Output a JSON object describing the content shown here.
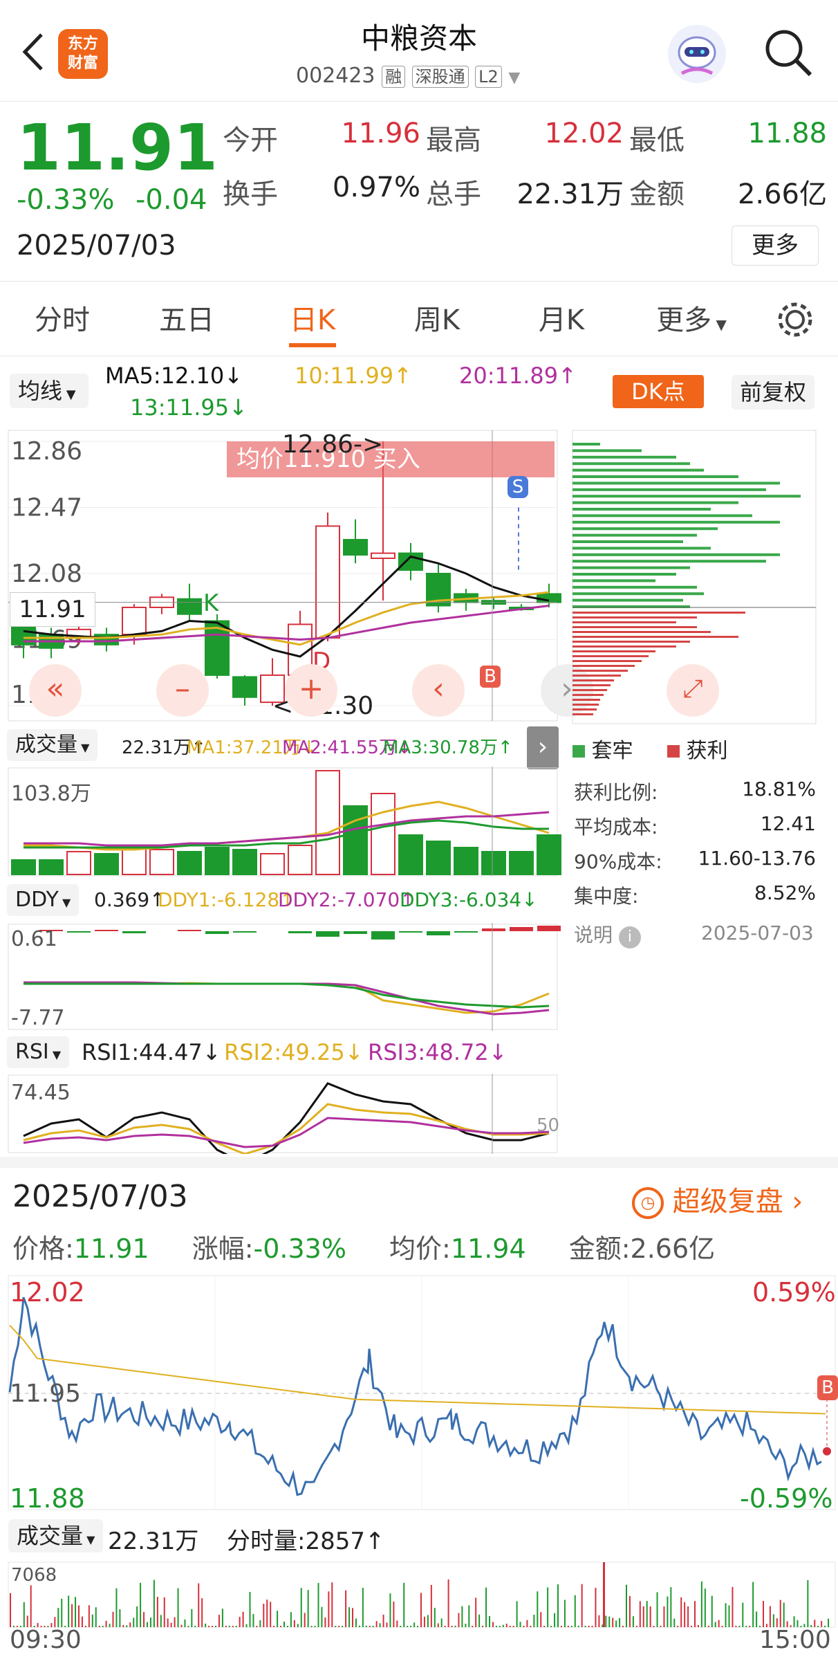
{
  "header": {
    "title": "中粮资本",
    "code": "002423",
    "tags": [
      "融",
      "深股通",
      "L2"
    ],
    "logo_text": [
      "东方",
      "财富"
    ],
    "icons": [
      "back-icon",
      "logo-icon",
      "robot-avatar-icon",
      "search-icon"
    ]
  },
  "quote": {
    "price": "11.91",
    "change_pct": "-0.33%",
    "change": "-0.04",
    "date": "2025/07/03",
    "more_label": "更多",
    "fields": [
      {
        "label": "今开",
        "value": "11.96",
        "color": "up"
      },
      {
        "label": "最高",
        "value": "12.02",
        "color": "up"
      },
      {
        "label": "最低",
        "value": "11.88",
        "color": "dn"
      },
      {
        "label": "换手",
        "value": "0.97%",
        "color": "n"
      },
      {
        "label": "总手",
        "value": "22.31万",
        "color": "n"
      },
      {
        "label": "金额",
        "value": "2.66亿",
        "color": "n"
      }
    ]
  },
  "tabs": [
    {
      "label": "分时",
      "active": false
    },
    {
      "label": "五日",
      "active": false
    },
    {
      "label": "日K",
      "active": true
    },
    {
      "label": "周K",
      "active": false
    },
    {
      "label": "月K",
      "active": false
    },
    {
      "label": "更多",
      "active": false
    }
  ],
  "ma_bar": {
    "selector": "均线",
    "ma5": "MA5:12.10↓",
    "ma10": "10:11.99↑",
    "ma20": "20:11.89↑",
    "ma13": "13:11.95↓",
    "dk_label": "DK点",
    "fq_label": "前复权"
  },
  "kchart": {
    "y_labels": [
      "12.86",
      "12.47",
      "12.08",
      "11.69",
      "11.30"
    ],
    "current_price": "11.91",
    "high_marker": "12.86->",
    "low_marker": "<-11.30",
    "banner": "均价11.910 买入",
    "marker_s": "S",
    "marker_b": "B",
    "marker_k": "K",
    "marker_d": "D",
    "candles": [
      {
        "o": 11.78,
        "c": 11.66,
        "h": 11.8,
        "l": 11.58
      },
      {
        "o": 11.72,
        "c": 11.64,
        "h": 11.76,
        "l": 11.58
      },
      {
        "o": 11.7,
        "c": 11.75,
        "h": 11.77,
        "l": 11.66
      },
      {
        "o": 11.72,
        "c": 11.66,
        "h": 11.76,
        "l": 11.62
      },
      {
        "o": 11.72,
        "c": 11.88,
        "h": 11.9,
        "l": 11.66
      },
      {
        "o": 11.88,
        "c": 11.94,
        "h": 11.96,
        "l": 11.84
      },
      {
        "o": 11.93,
        "c": 11.84,
        "h": 12.02,
        "l": 11.8
      },
      {
        "o": 11.8,
        "c": 11.48,
        "h": 11.84,
        "l": 11.46
      },
      {
        "o": 11.47,
        "c": 11.35,
        "h": 11.48,
        "l": 11.3
      },
      {
        "o": 11.32,
        "c": 11.48,
        "h": 11.58,
        "l": 11.3
      },
      {
        "o": 11.48,
        "c": 11.78,
        "h": 11.86,
        "l": 11.46
      },
      {
        "o": 11.7,
        "c": 12.36,
        "h": 12.44,
        "l": 11.68
      },
      {
        "o": 12.28,
        "c": 12.19,
        "h": 12.4,
        "l": 12.14
      },
      {
        "o": 12.17,
        "c": 12.2,
        "h": 12.86,
        "l": 11.92
      },
      {
        "o": 12.2,
        "c": 12.1,
        "h": 12.26,
        "l": 12.04
      },
      {
        "o": 12.08,
        "c": 11.89,
        "h": 12.14,
        "l": 11.85
      },
      {
        "o": 11.96,
        "c": 11.91,
        "h": 11.99,
        "l": 11.86
      },
      {
        "o": 11.92,
        "c": 11.9,
        "h": 11.94,
        "l": 11.87
      },
      {
        "o": 11.88,
        "c": 11.87,
        "h": 11.9,
        "l": 11.86
      },
      {
        "o": 11.96,
        "c": 11.91,
        "h": 12.02,
        "l": 11.88
      }
    ],
    "ma_values": {
      "ma5": [
        11.74,
        11.72,
        11.71,
        11.7,
        11.72,
        11.74,
        11.8,
        11.79,
        11.7,
        11.63,
        11.59,
        11.71,
        11.86,
        12.02,
        12.18,
        12.14,
        12.08,
        12.0,
        11.95,
        11.92
      ],
      "ma10": [
        11.7,
        11.7,
        11.7,
        11.7,
        11.71,
        11.72,
        11.75,
        11.76,
        11.72,
        11.69,
        11.66,
        11.72,
        11.79,
        11.85,
        11.9,
        11.92,
        11.93,
        11.94,
        11.95,
        11.97
      ],
      "ma20": [
        11.68,
        11.68,
        11.68,
        11.68,
        11.69,
        11.7,
        11.71,
        11.72,
        11.71,
        11.7,
        11.69,
        11.7,
        11.73,
        11.76,
        11.79,
        11.81,
        11.83,
        11.85,
        11.87,
        11.89
      ]
    }
  },
  "chip_panel": {
    "legend": [
      {
        "label": "套牢",
        "color": "#3aa84a"
      },
      {
        "label": "获利",
        "color": "#d64545"
      }
    ],
    "rows": [
      {
        "label": "获利比例:",
        "value": "18.81%"
      },
      {
        "label": "平均成本:",
        "value": "12.41"
      },
      {
        "label": "90%成本:",
        "value": "11.60-13.76"
      },
      {
        "label": "集中度:",
        "value": "8.52%"
      }
    ],
    "note_label": "说明",
    "note_date": "2025-07-03"
  },
  "volume": {
    "selector": "成交量",
    "value": "22.31万↑",
    "ma1": "MA1:37.21万↓",
    "ma2": "MA2:41.55万↓",
    "ma3": "MA3:30.78万↑",
    "max_label": "103.8万",
    "bars": [
      14,
      14,
      22,
      20,
      26,
      24,
      22,
      26,
      24,
      20,
      28,
      100,
      66,
      78,
      38,
      32,
      26,
      22,
      22,
      38
    ]
  },
  "ddy": {
    "selector": "DDY",
    "value": "0.369↑",
    "ddy1": "DDY1:-6.128↑",
    "ddy2": "DDY2:-7.070↑",
    "ddy3": "DDY3:-6.034↓",
    "y_top": "0.61",
    "y_bottom": "-7.77"
  },
  "rsi": {
    "selector": "RSI",
    "rsi1": "RSI1:44.47↓",
    "rsi2": "RSI2:49.25↓",
    "rsi3": "RSI3:48.72↓",
    "y_top": "74.45",
    "mid_label": "50"
  },
  "intraday": {
    "date": "2025/07/03",
    "replay_label": "超级复盘",
    "price": "价格:",
    "price_val": "11.91",
    "change": "涨幅:",
    "change_val": "-0.33%",
    "avg": "均价:",
    "avg_val": "11.94",
    "amount": "金额:2.66亿",
    "y_high": "12.02",
    "y_mid": "11.95",
    "y_low": "11.88",
    "pct_high": "0.59%",
    "pct_low": "-0.59%",
    "marker_b": "B",
    "vol_selector": "成交量",
    "vol_value": "22.31万",
    "fs_label": "分时量:2857↑",
    "vol_max": "7068",
    "time_start": "09:30",
    "time_end": "15:00"
  },
  "colors": {
    "up": "#d6303b",
    "down": "#1d9a2e",
    "ma5": "#111111",
    "ma10": "#e0b020",
    "ma20": "#b0309e",
    "ma13": "#1d9a2e",
    "accent": "#f0651a"
  }
}
